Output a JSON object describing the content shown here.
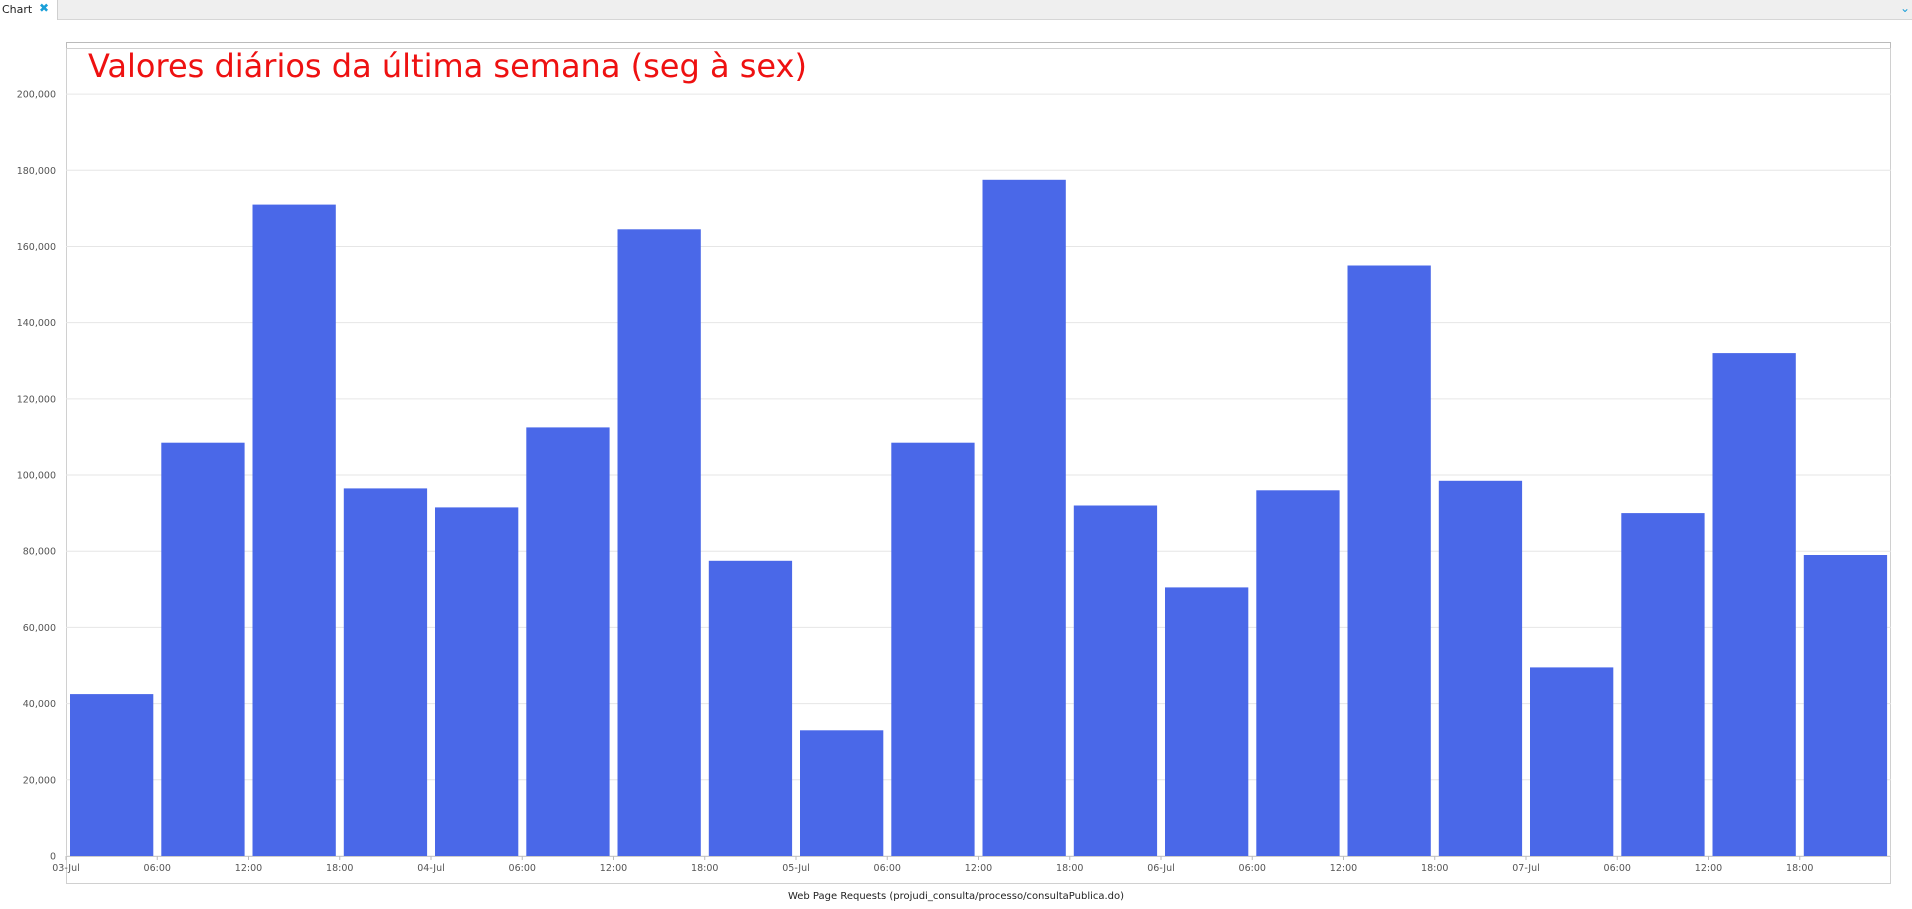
{
  "tab": {
    "label": "Chart"
  },
  "chart_data": {
    "type": "bar",
    "title": "Valores diários da última semana (seg à sex)",
    "xlabel": "Web Page Requests (projudi_consulta/processo/consultaPublica.do)",
    "ylabel": "",
    "ylim": [
      0,
      210000
    ],
    "yticks": [
      0,
      20000,
      40000,
      60000,
      80000,
      100000,
      120000,
      140000,
      160000,
      180000,
      200000
    ],
    "ytick_labels": [
      "0",
      "20,000",
      "40,000",
      "60,000",
      "80,000",
      "100,000",
      "120,000",
      "140,000",
      "160,000",
      "180,000",
      "200,000"
    ],
    "xticks": [
      "03-Jul",
      "06:00",
      "12:00",
      "18:00",
      "04-Jul",
      "06:00",
      "12:00",
      "18:00",
      "05-Jul",
      "06:00",
      "12:00",
      "18:00",
      "06-Jul",
      "06:00",
      "12:00",
      "18:00",
      "07-Jul",
      "06:00",
      "12:00",
      "18:00"
    ],
    "values": [
      42500,
      108500,
      171000,
      96500,
      91500,
      112500,
      164500,
      77500,
      33000,
      108500,
      177500,
      92000,
      70500,
      96000,
      155000,
      98500,
      49500,
      90000,
      132000,
      79000
    ],
    "bar_color": "#4a68e8",
    "grid": true
  }
}
